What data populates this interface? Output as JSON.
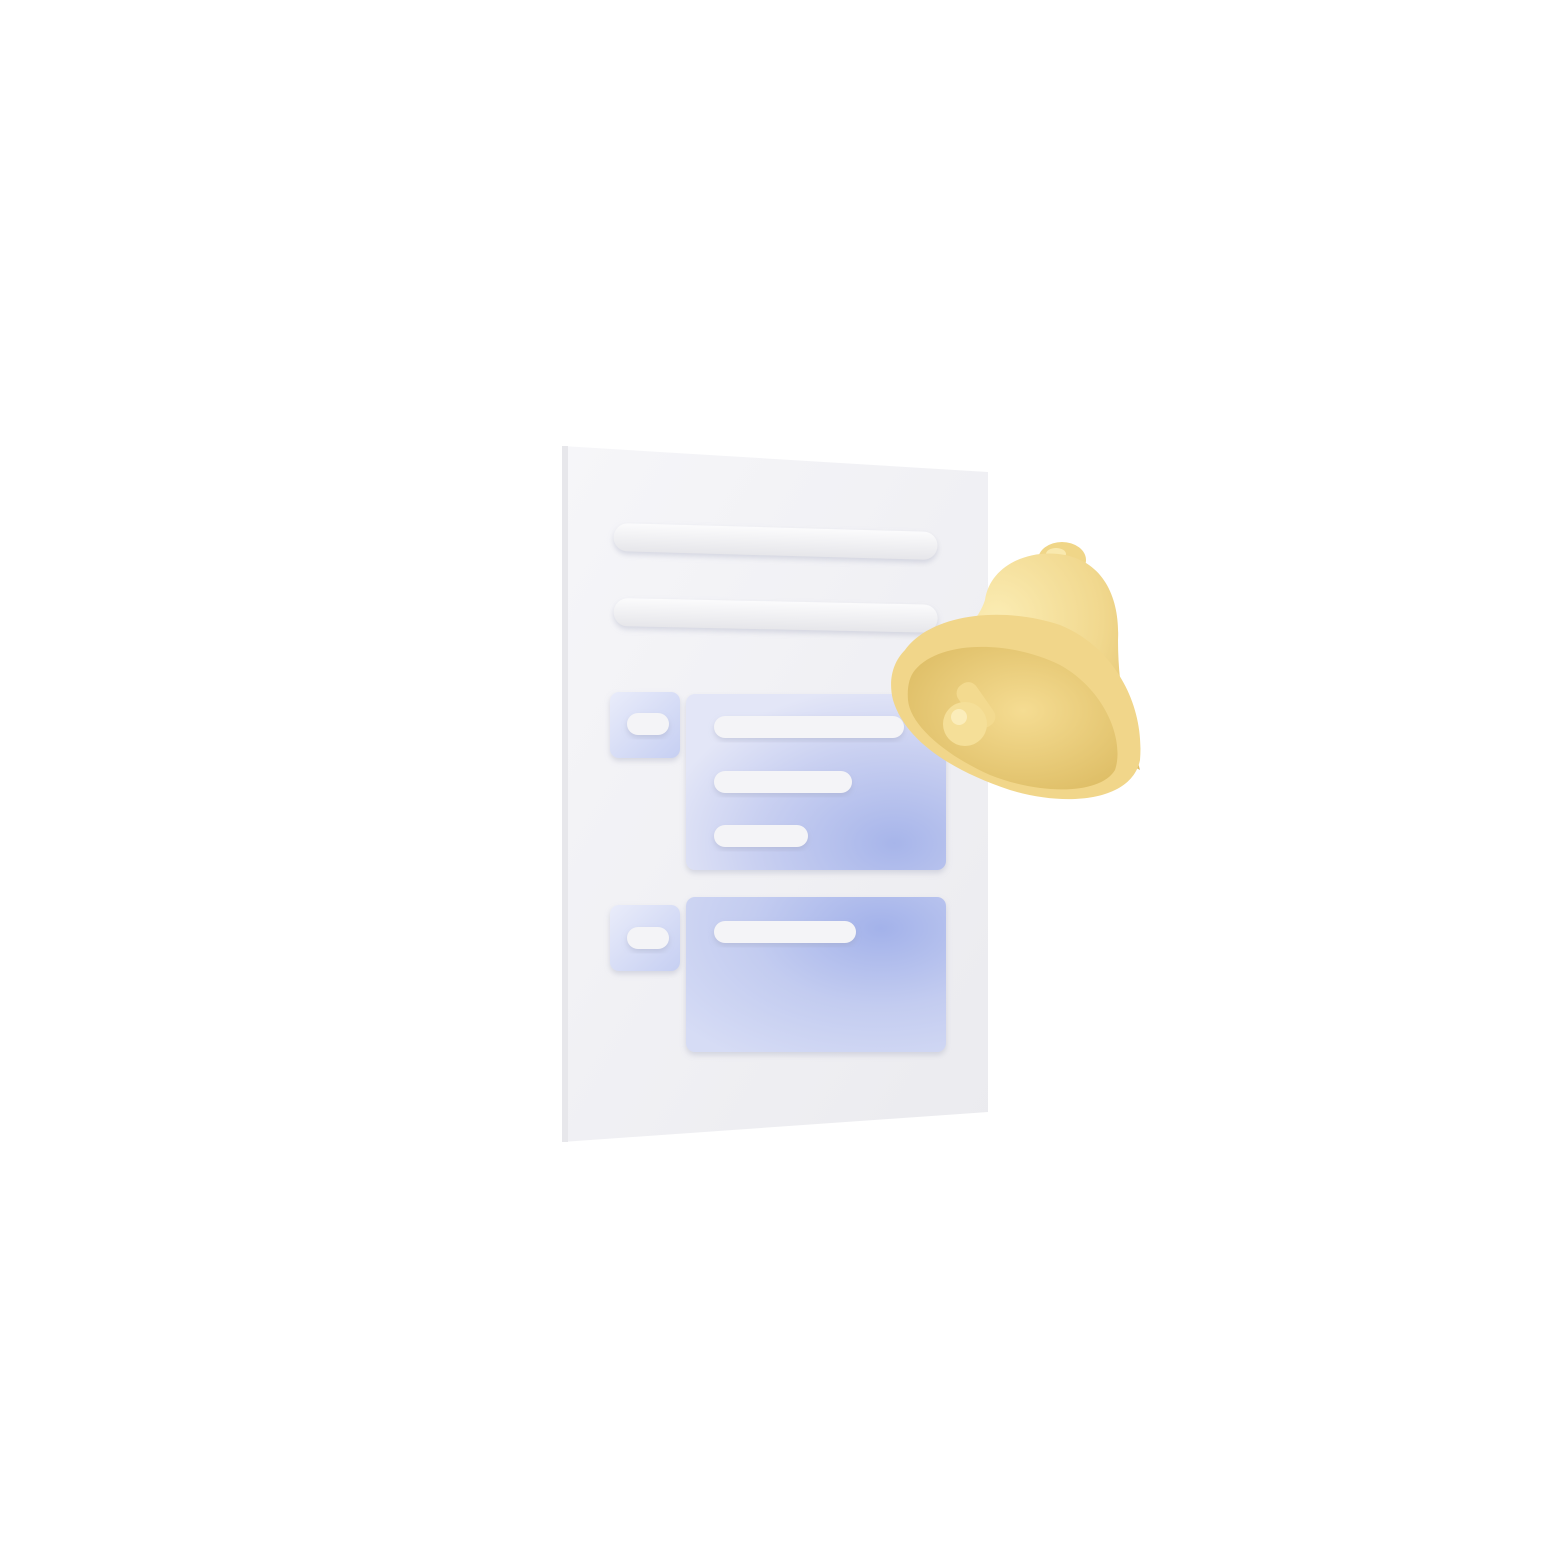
{
  "scene": {
    "subject": "document-with-notification-bell",
    "icons": [
      "document-icon",
      "bell-icon"
    ],
    "colors": {
      "background": "#ffffff",
      "paper": "#f1f1f4",
      "text_bar": "#f4f4f6",
      "card_blue": "#c2cbef",
      "card_blue_deep": "#9fb0e8",
      "bell_yellow": "#f3dc92",
      "bell_shadow": "#e2c36c"
    }
  }
}
